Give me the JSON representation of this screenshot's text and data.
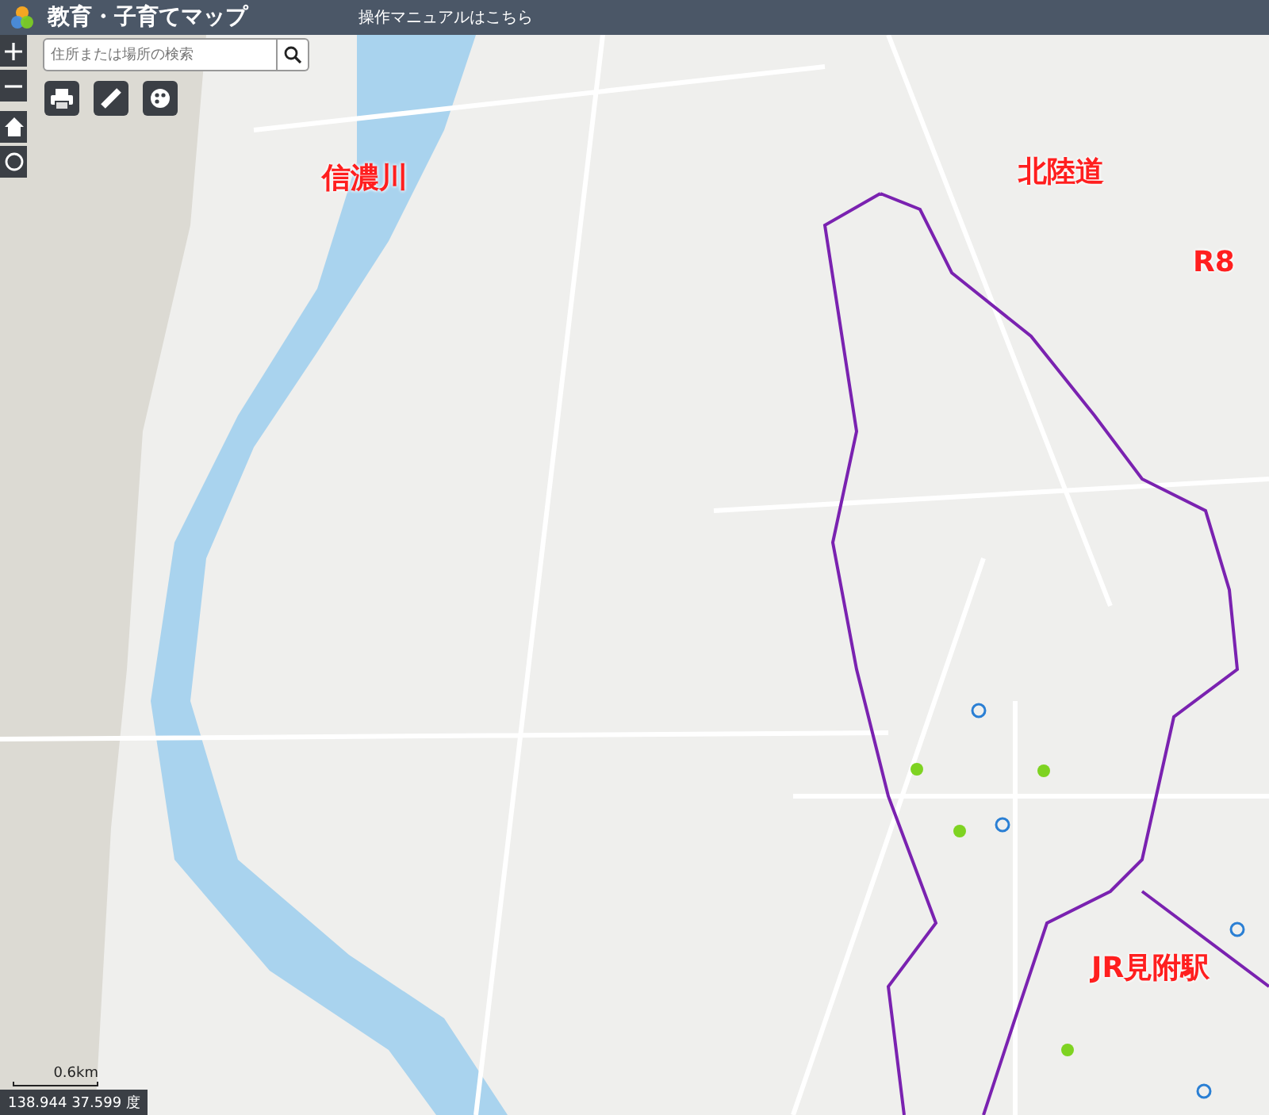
{
  "header": {
    "title": "教育・子育てマップ",
    "manual_link": "操作マニュアルはこちら"
  },
  "search": {
    "placeholder": "住所または場所の検索"
  },
  "map_annotations": [
    {
      "text": "信濃川"
    },
    {
      "text": "北陸道"
    },
    {
      "text": "R8"
    },
    {
      "text": "JR見附駅"
    }
  ],
  "scale_bar": {
    "label": "0.6km"
  },
  "coordinates": "138.944 37.599 度"
}
